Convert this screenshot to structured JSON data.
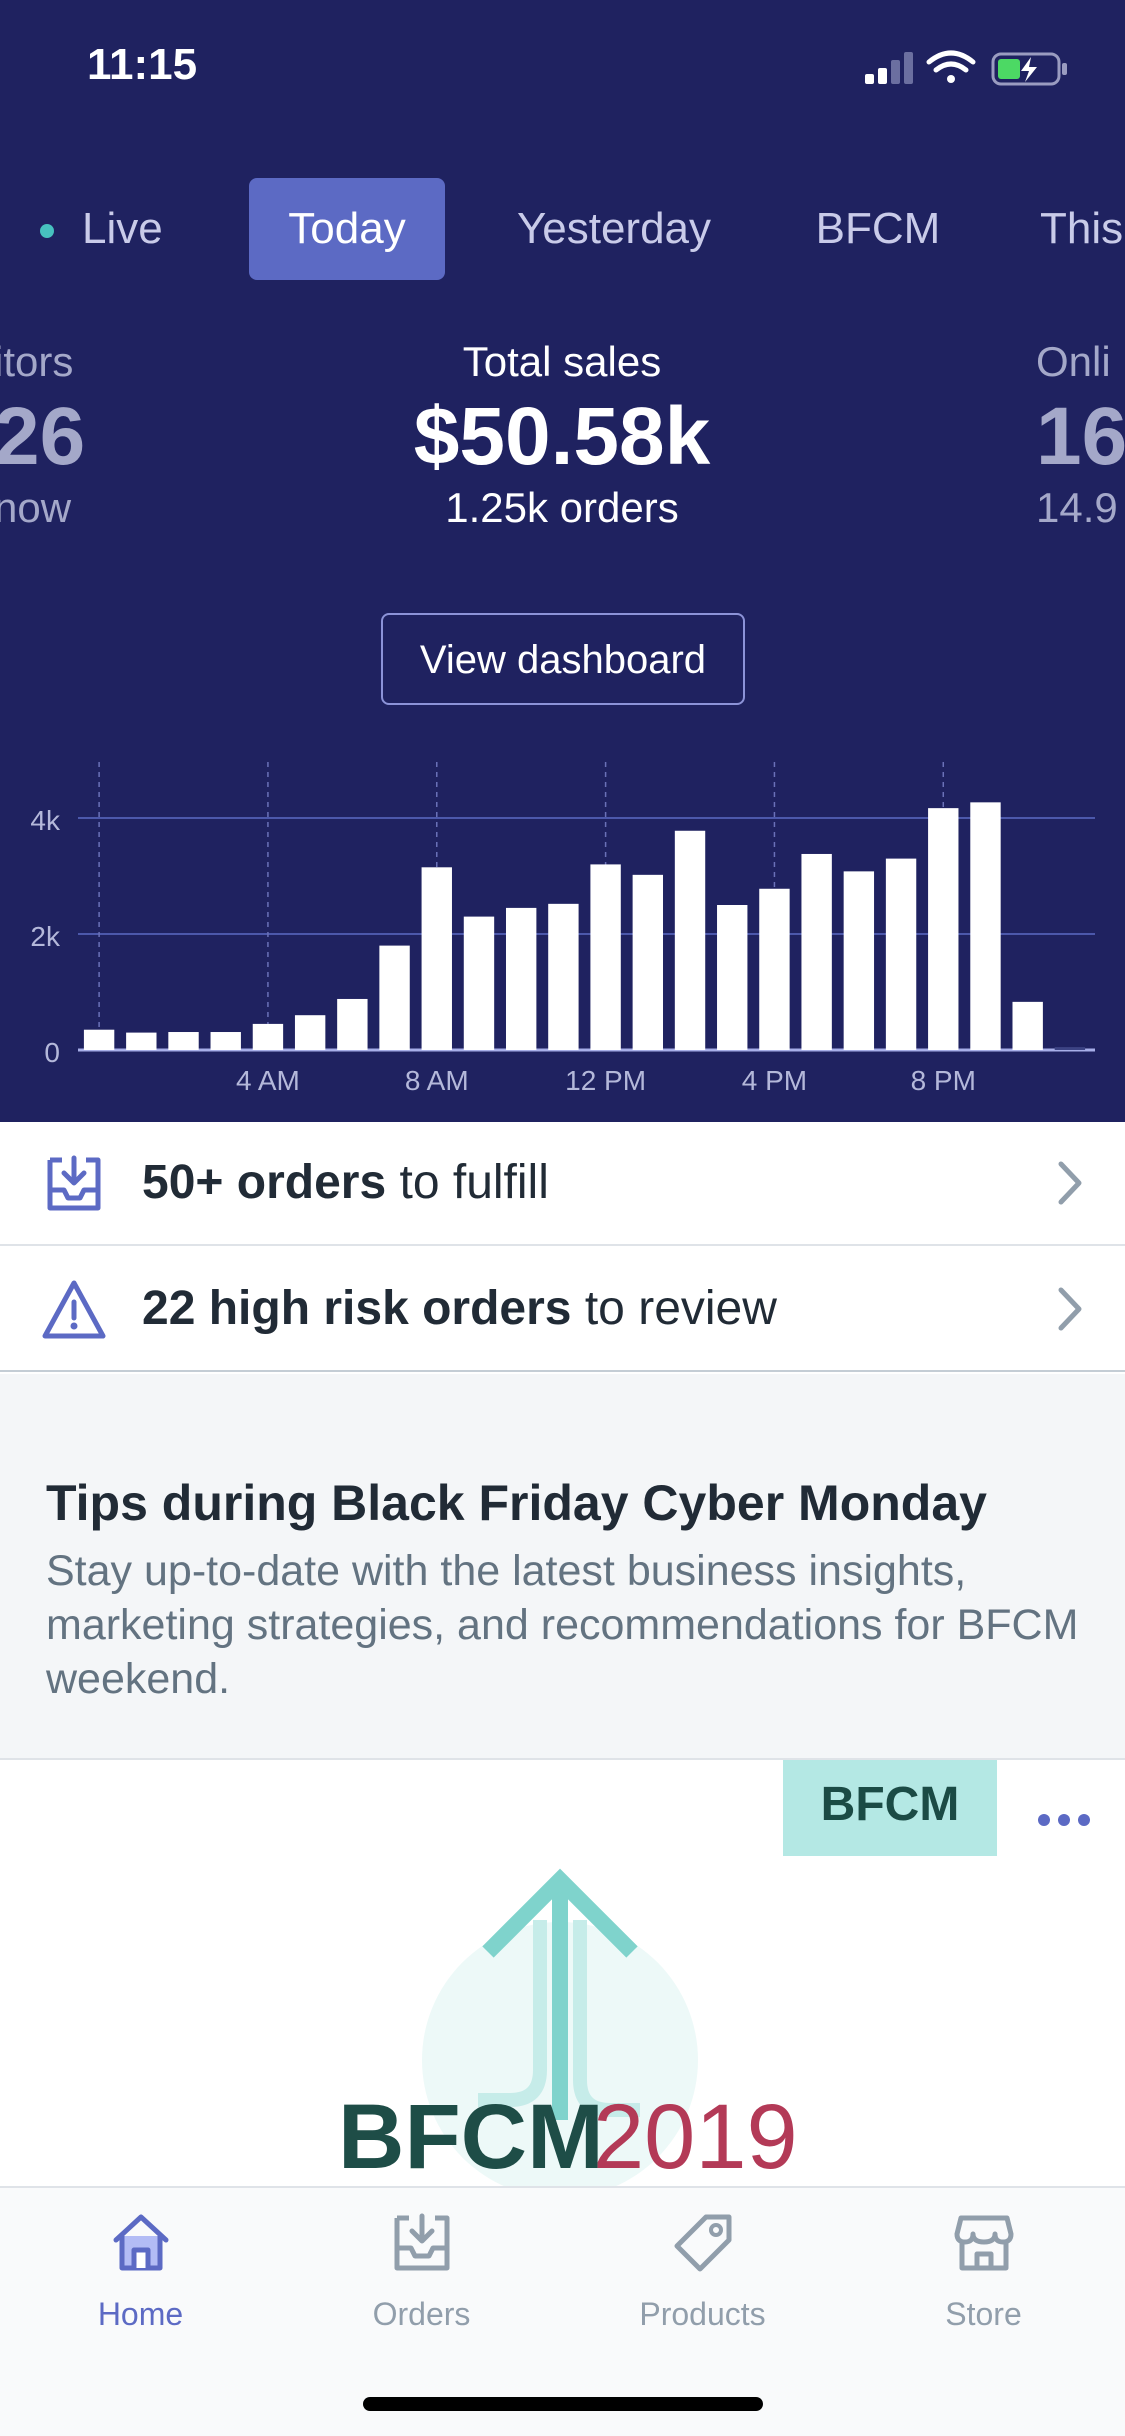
{
  "status_bar": {
    "time": "11:15"
  },
  "period_tabs": [
    {
      "label": "Live"
    },
    {
      "label": "Today"
    },
    {
      "label": "Yesterday"
    },
    {
      "label": "BFCM"
    },
    {
      "label": "This"
    }
  ],
  "metrics": {
    "left_partial": {
      "label": "itors",
      "value": "26",
      "sub": "now"
    },
    "main": {
      "label": "Total sales",
      "value": "$50.58k",
      "sub": "1.25k orders"
    },
    "right_partial": {
      "label": "Onli",
      "value": "16",
      "sub": "14.9"
    }
  },
  "view_dashboard_label": "View dashboard",
  "chart_data": {
    "type": "bar",
    "x": [
      "12 AM",
      "1 AM",
      "2 AM",
      "3 AM",
      "4 AM",
      "5 AM",
      "6 AM",
      "7 AM",
      "8 AM",
      "9 AM",
      "10 AM",
      "11 AM",
      "12 PM",
      "1 PM",
      "2 PM",
      "3 PM",
      "4 PM",
      "5 PM",
      "6 PM",
      "7 PM",
      "8 PM",
      "9 PM",
      "10 PM",
      "11 PM"
    ],
    "values": [
      350,
      300,
      310,
      310,
      450,
      600,
      880,
      1800,
      3150,
      2300,
      2450,
      2520,
      3200,
      3020,
      3780,
      2500,
      2780,
      3380,
      3080,
      3300,
      4170,
      4270,
      830,
      50
    ],
    "x_tick_labels": [
      "4 AM",
      "8 AM",
      "12 PM",
      "4 PM",
      "8 PM"
    ],
    "y_tick_labels": [
      "0",
      "2k",
      "4k"
    ],
    "ylim": [
      0,
      5000
    ],
    "grid": true,
    "colors": {
      "bars": "#ffffff",
      "grid": "#5c6ac4"
    }
  },
  "tasks": [
    {
      "bold": "50+ orders",
      "rest": " to fulfill",
      "icon": "inbox-download-icon"
    },
    {
      "bold": "22 high risk orders",
      "rest": " to review",
      "icon": "warning-triangle-icon"
    }
  ],
  "tips": {
    "title": "Tips during Black Friday Cyber Monday",
    "body": "Stay up-to-date with the latest business insights, marketing strategies, and recommendations for BFCM weekend."
  },
  "card": {
    "badge": "BFCM",
    "title_word": "BFCM",
    "title_year": "2019"
  },
  "tab_bar": [
    {
      "label": "Home",
      "icon": "home-icon"
    },
    {
      "label": "Orders",
      "icon": "orders-icon"
    },
    {
      "label": "Products",
      "icon": "tag-icon"
    },
    {
      "label": "Store",
      "icon": "store-icon"
    }
  ],
  "colors": {
    "hero_bg": "#1f2260",
    "accent": "#5c6ac4",
    "teal": "#47c1bf",
    "text": "#212b36",
    "muted": "#637381"
  }
}
